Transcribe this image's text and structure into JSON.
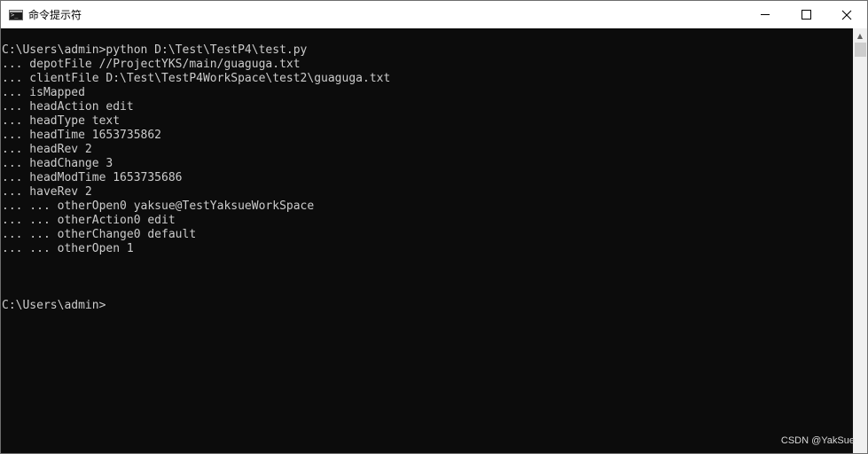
{
  "window": {
    "title": "命令提示符"
  },
  "console": {
    "lines": [
      "C:\\Users\\admin>python D:\\Test\\TestP4\\test.py",
      "... depotFile //ProjectYKS/main/guaguga.txt",
      "... clientFile D:\\Test\\TestP4WorkSpace\\test2\\guaguga.txt",
      "... isMapped",
      "... headAction edit",
      "... headType text",
      "... headTime 1653735862",
      "... headRev 2",
      "... headChange 3",
      "... headModTime 1653735686",
      "... haveRev 2",
      "... ... otherOpen0 yaksue@TestYaksueWorkSpace",
      "... ... otherAction0 edit",
      "... ... otherChange0 default",
      "... ... otherOpen 1",
      "",
      "",
      "",
      "C:\\Users\\admin>"
    ]
  },
  "watermark": "CSDN @YakSue",
  "colors": {
    "console_bg": "#0c0c0c",
    "console_text": "#cccccc",
    "titlebar_bg": "#ffffff"
  },
  "icons": {
    "app": "cmd-icon",
    "minimize": "minimize-icon",
    "maximize": "maximize-icon",
    "close": "close-icon"
  }
}
